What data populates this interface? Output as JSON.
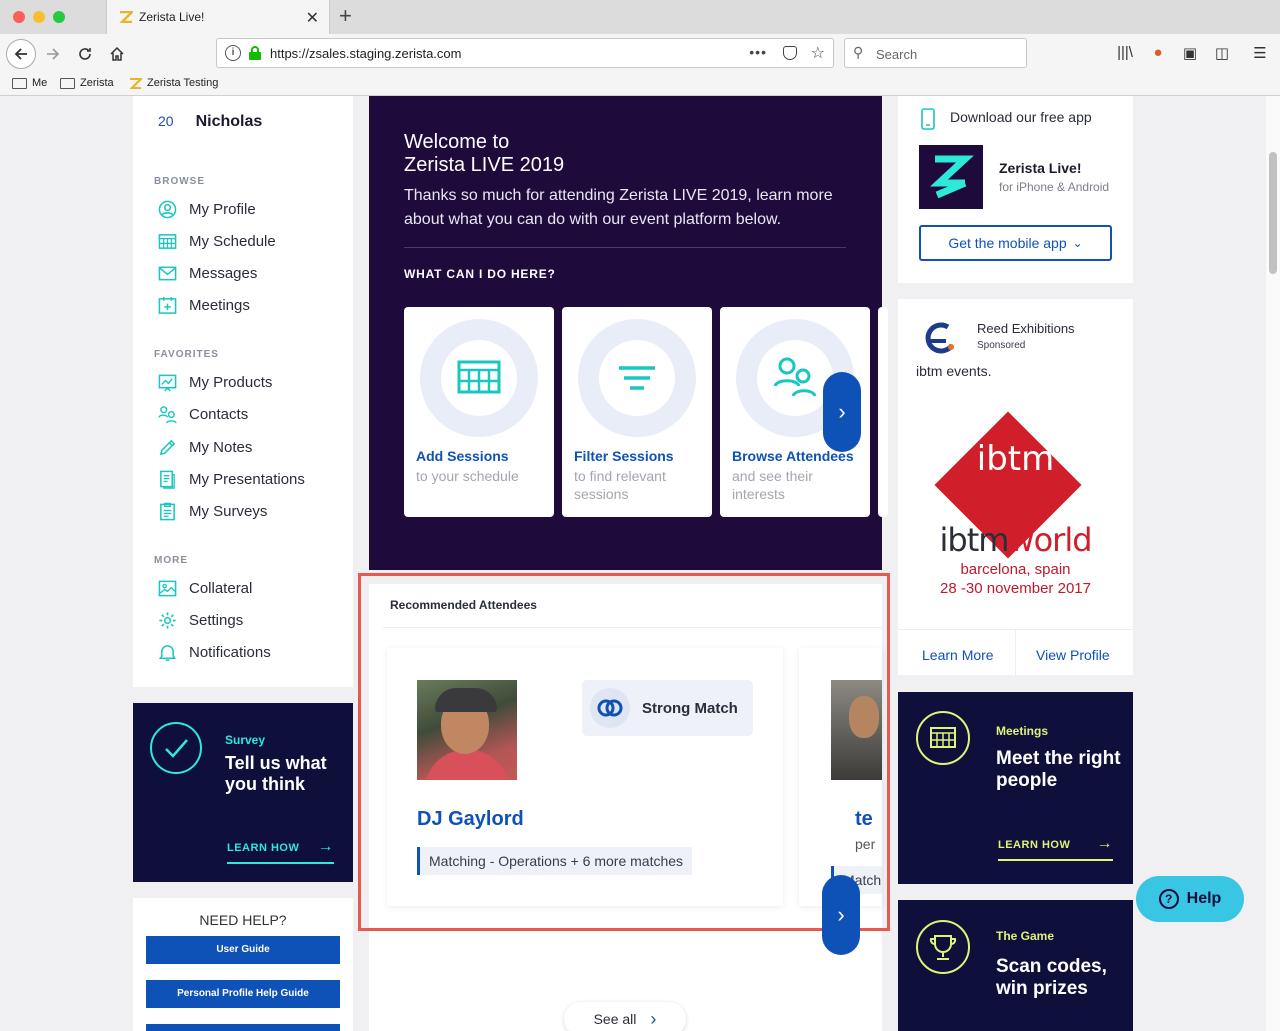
{
  "browser": {
    "tab_title": "Zerista Live!",
    "url": "https://zsales.staging.zerista.com",
    "search_placeholder": "Search",
    "bookmarks": [
      "Me",
      "Zerista",
      "Zerista Testing"
    ]
  },
  "user": {
    "number": "20",
    "name": "Nicholas"
  },
  "sidebar": {
    "browse_header": "BROWSE",
    "browse": [
      {
        "label": "My Profile",
        "icon": "user-circle-icon"
      },
      {
        "label": "My Schedule",
        "icon": "calendar-grid-icon"
      },
      {
        "label": "Messages",
        "icon": "envelope-icon"
      },
      {
        "label": "Meetings",
        "icon": "calendar-plus-icon"
      }
    ],
    "favorites_header": "FAVORITES",
    "favorites": [
      {
        "label": "My Products",
        "icon": "product-icon"
      },
      {
        "label": "Contacts",
        "icon": "contacts-icon"
      },
      {
        "label": "My Notes",
        "icon": "pencil-icon"
      },
      {
        "label": "My Presentations",
        "icon": "presentation-icon"
      },
      {
        "label": "My Surveys",
        "icon": "survey-icon"
      }
    ],
    "more_header": "MORE",
    "more": [
      {
        "label": "Collateral",
        "icon": "image-icon"
      },
      {
        "label": "Settings",
        "icon": "gear-icon"
      },
      {
        "label": "Notifications",
        "icon": "bell-icon"
      }
    ]
  },
  "survey": {
    "label": "Survey",
    "heading": "Tell us what you think",
    "cta": "LEARN HOW"
  },
  "help_box": {
    "title": "NEED HELP?",
    "buttons": [
      "User Guide",
      "Personal Profile Help Guide"
    ]
  },
  "hero": {
    "title_line1": "Welcome to",
    "title_line2": "Zerista LIVE 2019",
    "body": "Thanks so much for attending Zerista LIVE 2019, learn more about what you can do with our event platform below.",
    "question": "WHAT CAN I DO HERE?",
    "features": [
      {
        "title": "Add Sessions",
        "subtitle": "to your schedule",
        "icon": "calendar-grid-icon"
      },
      {
        "title": "Filter Sessions",
        "subtitle": "to find relevant sessions",
        "icon": "filter-icon"
      },
      {
        "title": "Browse Attendees",
        "subtitle": "and see their interests",
        "icon": "attendees-icon"
      }
    ]
  },
  "recommended": {
    "title": "Recommended Attendees",
    "match_label": "Strong Match",
    "person_name": "DJ Gaylord",
    "match_tag": "Matching - Operations + 6 more matches",
    "next_name_fragment": "te",
    "next_sub_fragment": "per",
    "next_tag_fragment": "Match",
    "see_all": "See all"
  },
  "app_promo": {
    "title": "Download our free app",
    "app_name": "Zerista Live!",
    "platforms": "for iPhone & Android",
    "button": "Get the mobile app"
  },
  "ad": {
    "sponsor": "Reed Exhibitions",
    "sponsored": "Sponsored",
    "description": "ibtm events.",
    "logo_text": "ibtm",
    "world_a": "ibtm",
    "world_b": "world",
    "city": "barcelona, spain",
    "dates": "28 -30 november 2017",
    "link_learn": "Learn More",
    "link_profile": "View Profile"
  },
  "meetings_card": {
    "label": "Meetings",
    "heading": "Meet the right people",
    "cta": "LEARN HOW"
  },
  "game_card": {
    "label": "The Game",
    "heading": "Scan codes, win prizes"
  },
  "help_button": "Help",
  "colors": {
    "brand_blue": "#0e52b8",
    "navy": "#0e0f3a",
    "hero_purple": "#1f0a3c",
    "teal": "#2ee8d8",
    "lime": "#dff37a",
    "highlight_red": "#e8584e"
  }
}
